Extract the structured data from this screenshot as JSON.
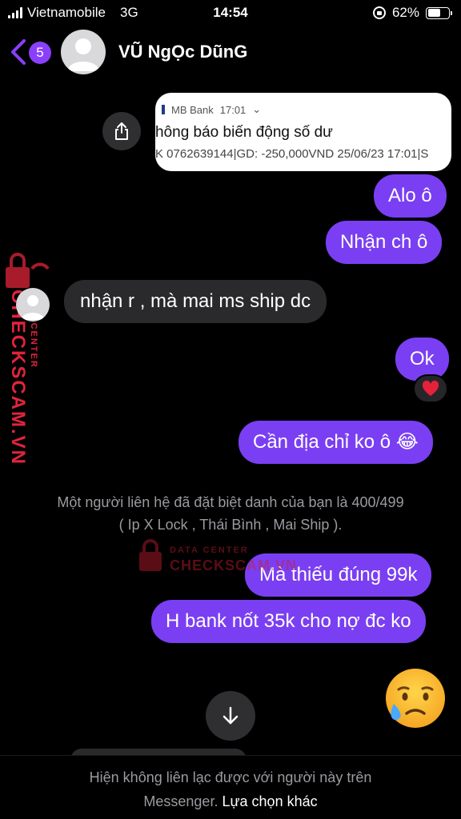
{
  "status_bar": {
    "carrier": "Vietnamobile",
    "network": "3G",
    "time": "14:54",
    "battery_percent": "62%",
    "battery_level": 0.62
  },
  "header": {
    "unread_count": "5",
    "contact_name": "VŨ NgỌc DũnG"
  },
  "shared_card": {
    "app_name": "MB Bank",
    "time": "17:01",
    "title": "hông báo biến động số dư",
    "body": "K 0762639144|GD: -250,000VND 25/06/23 17:01|S"
  },
  "messages": [
    {
      "id": "alo",
      "sender": "me",
      "text": "Alo ô"
    },
    {
      "id": "nhan",
      "sender": "me",
      "text": "Nhận ch ô"
    },
    {
      "id": "reply",
      "sender": "them",
      "text": "nhận r , mà mai ms ship dc"
    },
    {
      "id": "ok",
      "sender": "me",
      "text": "Ok",
      "reaction": "❤️"
    },
    {
      "id": "dia-chi",
      "sender": "me",
      "text": "Cần địa chỉ ko ô 😂"
    },
    {
      "id": "thieu",
      "sender": "me",
      "text": "Mà thiếu đúng 99k"
    },
    {
      "id": "bank",
      "sender": "me",
      "text": "H bank nốt 35k cho nợ đc ko"
    }
  ],
  "notice": {
    "line1": "Một người liên hệ đã đặt biệt danh của bạn là 400/499",
    "line2": "( Ip X Lock , Thái Bình , Mai Ship )."
  },
  "watermark": {
    "label_small": "DATA CENTER",
    "label_big": "CHECKSCAM.VN"
  },
  "footer": {
    "line1": "Hiện không liên lạc được với người này trên",
    "line2": "Messenger.",
    "link": "Lựa chọn khác"
  },
  "colors": {
    "my_bubble": "#7a3ff2",
    "their_bubble": "#2a2a2d",
    "badge": "#8a3ffc",
    "watermark": "#e0243a"
  },
  "icons": [
    "back-chevron-icon",
    "share-icon",
    "heart-icon",
    "sad-sweat-emoji-icon",
    "arrow-down-icon",
    "lock-icon"
  ]
}
